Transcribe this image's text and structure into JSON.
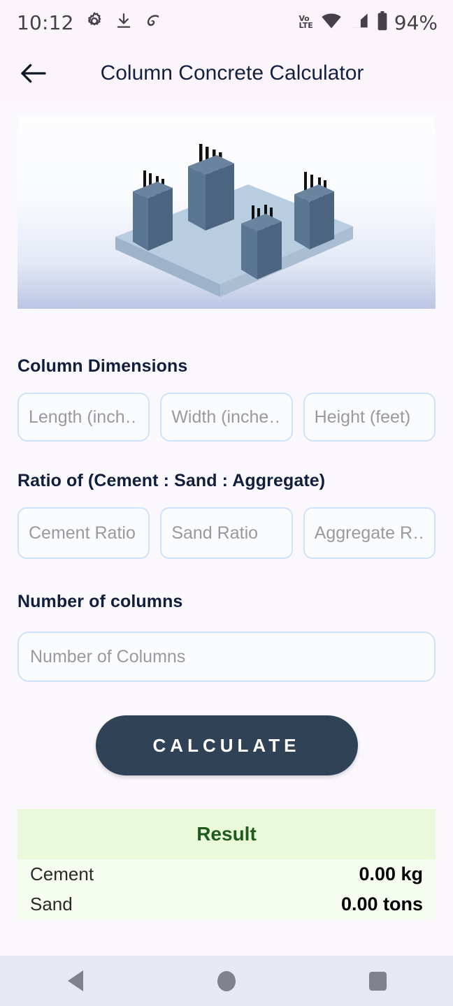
{
  "status_bar": {
    "time": "10:12",
    "left_icons": [
      "gear-icon",
      "download-icon",
      "airtel-logo-icon"
    ],
    "right_icons": [
      "volte-icon",
      "wifi-icon",
      "signal-icon",
      "battery-icon"
    ],
    "volte_line1": "Vo",
    "volte_line2": "LTE",
    "battery_percent": "94%"
  },
  "app_bar": {
    "back_icon": "arrow-left-icon",
    "title": "Column Concrete Calculator"
  },
  "illustration": {
    "name": "concrete-columns-isometric-illustration",
    "colors": {
      "slab_top": "#b9cde0",
      "slab_front": "#a9bed3",
      "slab_side": "#9db3c9",
      "column_top": "#6a84a0",
      "column_left": "#5b7692",
      "column_right": "#4b6480",
      "rebar": "#111111",
      "bg_top": "#fdfdfe",
      "bg_bottom": "#bcc6e4"
    }
  },
  "sections": {
    "dimensions": {
      "title": "Column Dimensions",
      "fields": [
        {
          "name": "length-input",
          "placeholder": "Length (inches)",
          "display": "Length (inch…",
          "value": ""
        },
        {
          "name": "width-input",
          "placeholder": "Width (inches)",
          "display": "Width (inche…",
          "value": ""
        },
        {
          "name": "height-input",
          "placeholder": "Height (feet)",
          "display": "Height (feet)",
          "value": ""
        }
      ]
    },
    "ratio": {
      "title": "Ratio of (Cement : Sand : Aggregate)",
      "fields": [
        {
          "name": "cement-ratio-input",
          "placeholder": "Cement Ratio",
          "display": "Cement Ratio",
          "value": ""
        },
        {
          "name": "sand-ratio-input",
          "placeholder": "Sand Ratio",
          "display": "Sand Ratio",
          "value": ""
        },
        {
          "name": "aggregate-ratio-input",
          "placeholder": "Aggregate Ratio",
          "display": "Aggregate R…",
          "value": ""
        }
      ]
    },
    "columns": {
      "title": "Number of columns",
      "field": {
        "name": "number-of-columns-input",
        "placeholder": "Number of Columns",
        "display": "Number of Columns",
        "value": ""
      }
    }
  },
  "calculate_button": {
    "label": "CALCULATE",
    "bg_color": "#304356",
    "text_color": "#ffffff"
  },
  "result": {
    "header": "Result",
    "header_bg": "#eaf9da",
    "header_text_color": "#1d5c1c",
    "body_bg": "#f5fdf0",
    "rows": [
      {
        "label": "Cement",
        "value": "0.00 kg"
      },
      {
        "label": "Sand",
        "value": "0.00 tons"
      }
    ]
  },
  "nav_bar": {
    "back_icon": "triangle-back-icon",
    "home_icon": "circle-home-icon",
    "recent_icon": "square-recents-icon"
  }
}
